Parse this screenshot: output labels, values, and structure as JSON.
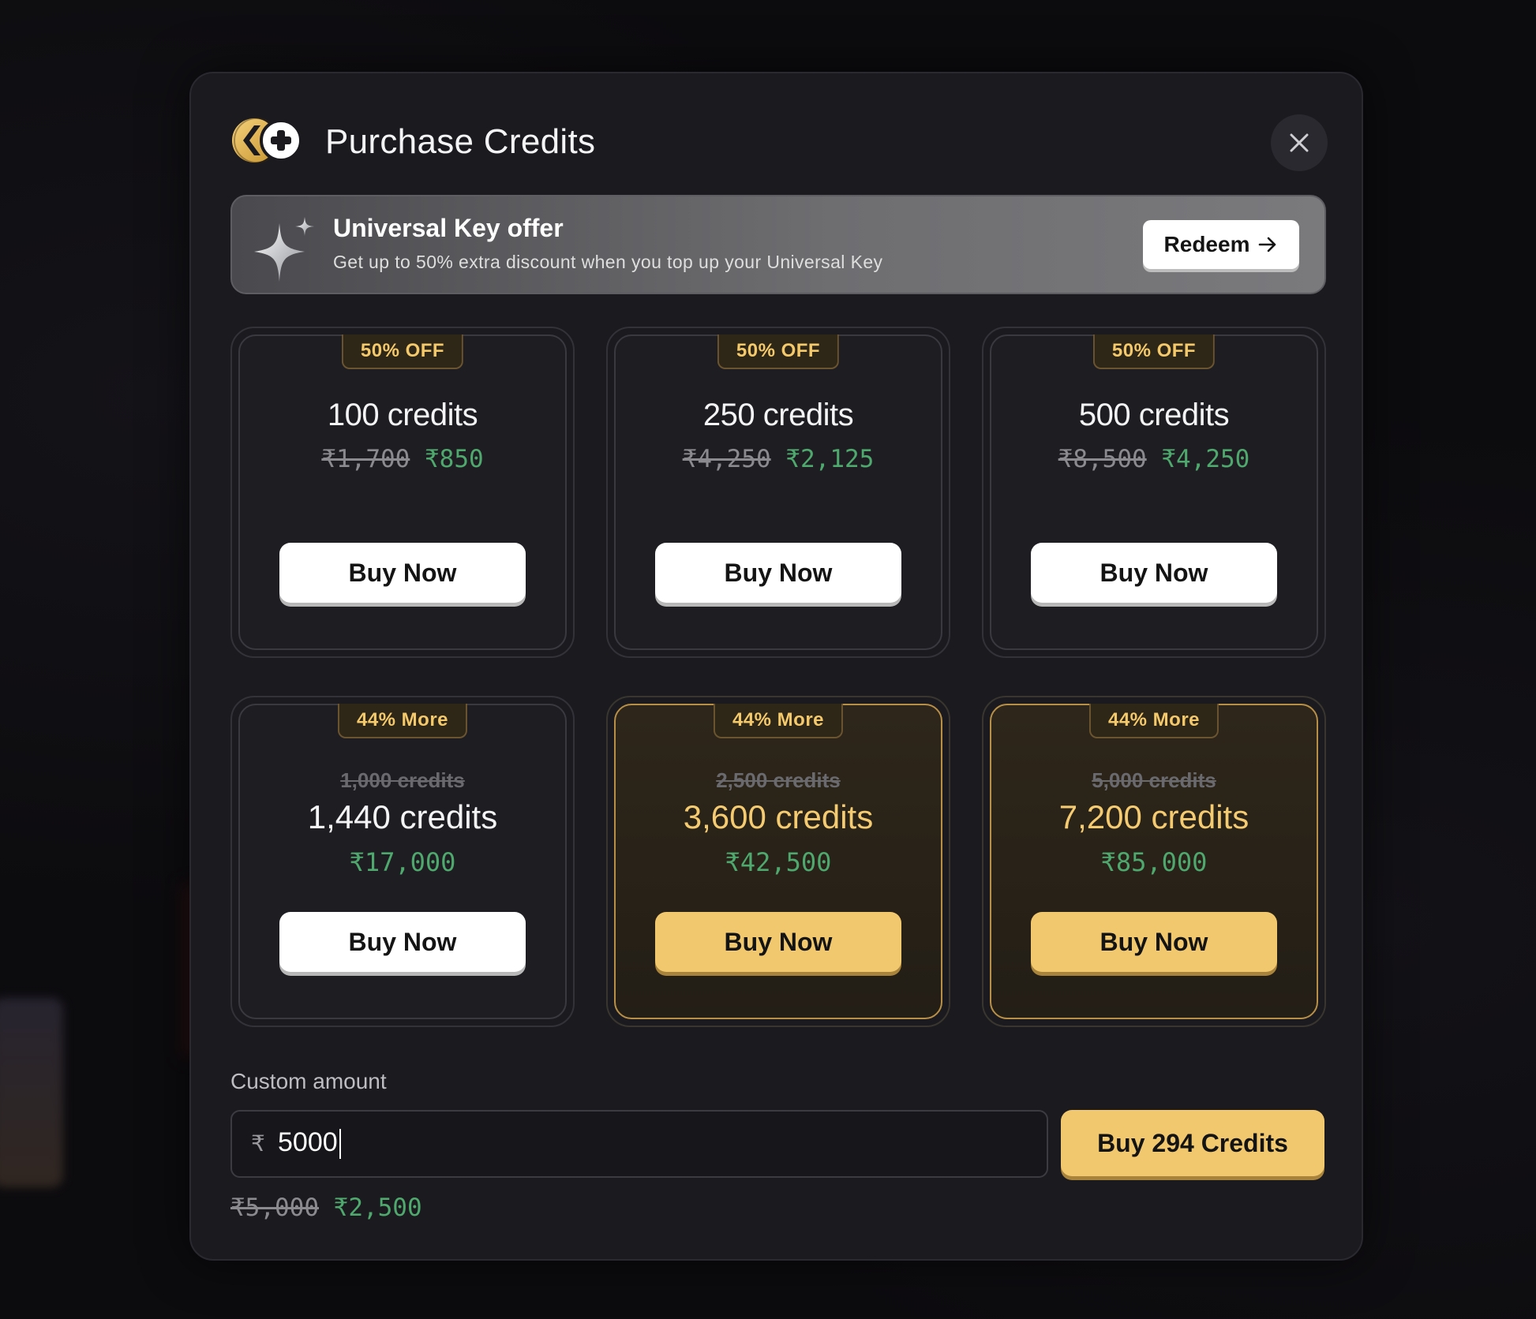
{
  "modal": {
    "title": "Purchase Credits",
    "close_icon": "close-icon"
  },
  "banner": {
    "title": "Universal Key offer",
    "subtitle": "Get up to 50% extra discount when you top up your Universal Key",
    "redeem_label": "Redeem"
  },
  "packs_row1": [
    {
      "badge": "50% OFF",
      "credits": "100 credits",
      "old_price": "₹1,700",
      "new_price": "₹850",
      "button": "Buy Now"
    },
    {
      "badge": "50% OFF",
      "credits": "250 credits",
      "old_price": "₹4,250",
      "new_price": "₹2,125",
      "button": "Buy Now"
    },
    {
      "badge": "50% OFF",
      "credits": "500 credits",
      "old_price": "₹8,500",
      "new_price": "₹4,250",
      "button": "Buy Now"
    }
  ],
  "packs_row2": [
    {
      "badge": "44% More",
      "old_credits": "1,000 credits",
      "credits": "1,440 credits",
      "price": "₹17,000",
      "button": "Buy Now"
    },
    {
      "badge": "44% More",
      "old_credits": "2,500 credits",
      "credits": "3,600 credits",
      "price": "₹42,500",
      "button": "Buy Now"
    },
    {
      "badge": "44% More",
      "old_credits": "5,000 credits",
      "credits": "7,200 credits",
      "price": "₹85,000",
      "button": "Buy Now"
    }
  ],
  "custom": {
    "label": "Custom amount",
    "currency": "₹",
    "value": "5000",
    "button": "Buy 294 Credits",
    "old_price": "₹5,000",
    "new_price": "₹2,500"
  },
  "colors": {
    "accent_gold": "#f2c86e",
    "price_green": "#4fa86d",
    "modal_bg": "#1b1a1f"
  }
}
